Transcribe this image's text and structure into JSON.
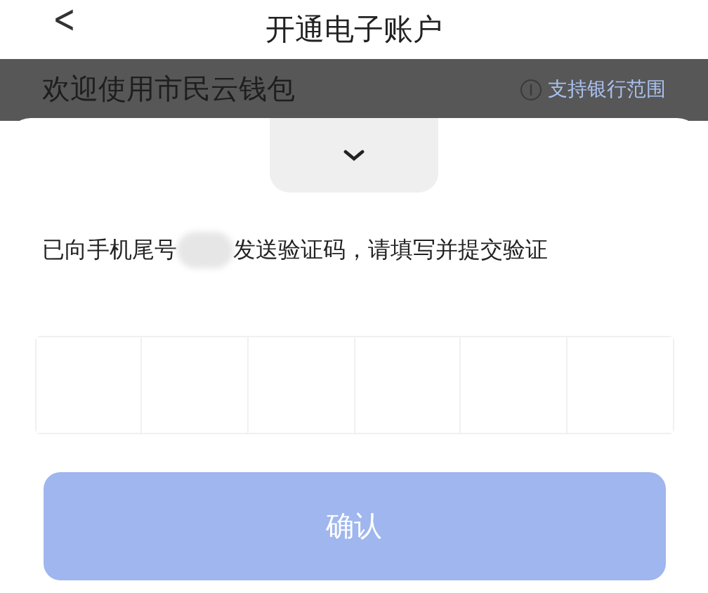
{
  "header": {
    "back": "<",
    "title": "开通电子账户"
  },
  "background_banner": {
    "welcome": "欢迎使用市民云钱包",
    "link": "支持银行范围"
  },
  "sheet": {
    "message_prefix": "已向手机尾号",
    "message_suffix": "发送验证码，请填写并提交验证",
    "code_cells": [
      {
        "kind": "digit"
      },
      {
        "kind": "digit"
      },
      {
        "kind": "digit"
      },
      {
        "kind": "digit"
      },
      {
        "kind": "digit"
      },
      {
        "kind": "digit"
      }
    ],
    "confirm": {
      "label": "确认",
      "disabled": true
    }
  }
}
